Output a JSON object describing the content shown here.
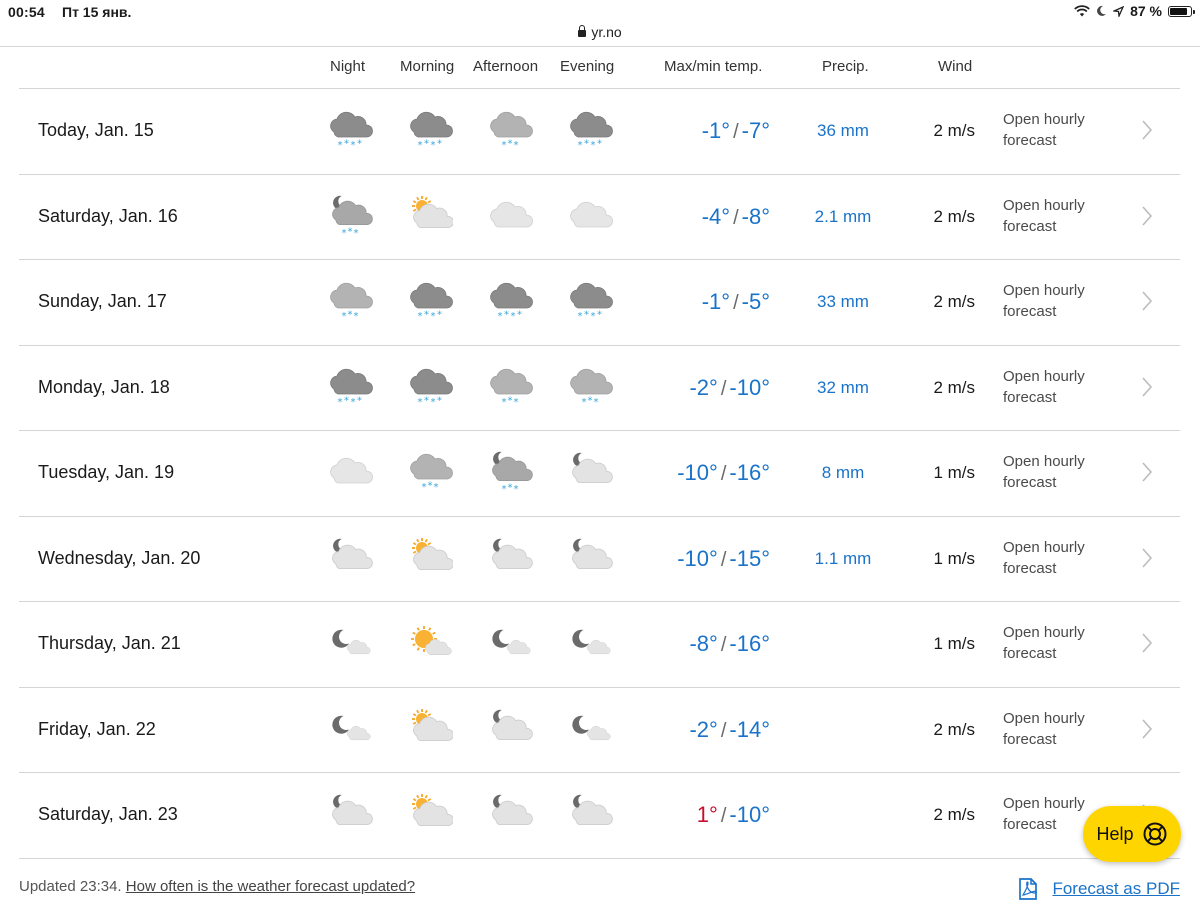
{
  "status_bar": {
    "time": "00:54",
    "date": "Пт 15 янв.",
    "url": "yr.no",
    "battery": "87 %",
    "battery_level": 0.87
  },
  "table": {
    "headers": {
      "night": "Night",
      "morning": "Morning",
      "afternoon": "Afternoon",
      "evening": "Evening",
      "temp": "Max/min temp.",
      "precip": "Precip.",
      "wind": "Wind"
    },
    "rows": [
      {
        "day": "Today, Jan. 15",
        "icons": [
          "heavy-snow",
          "heavy-snow",
          "light-snow",
          "heavy-snow"
        ],
        "max": "-1°",
        "min": "-7°",
        "max_warm": false,
        "precip": "36 mm",
        "wind": "2 m/s",
        "hourly": "Open hourly forecast"
      },
      {
        "day": "Saturday, Jan. 16",
        "icons": [
          "night-cloud-snow",
          "partly-sunny-cloud",
          "light-cloud",
          "light-cloud"
        ],
        "max": "-4°",
        "min": "-8°",
        "max_warm": false,
        "precip": "2.1 mm",
        "wind": "2 m/s",
        "hourly": "Open hourly forecast"
      },
      {
        "day": "Sunday, Jan. 17",
        "icons": [
          "light-snow",
          "heavy-snow",
          "heavy-snow",
          "heavy-snow"
        ],
        "max": "-1°",
        "min": "-5°",
        "max_warm": false,
        "precip": "33 mm",
        "wind": "2 m/s",
        "hourly": "Open hourly forecast"
      },
      {
        "day": "Monday, Jan. 18",
        "icons": [
          "heavy-snow",
          "heavy-snow",
          "light-snow",
          "light-snow"
        ],
        "max": "-2°",
        "min": "-10°",
        "max_warm": false,
        "precip": "32 mm",
        "wind": "2 m/s",
        "hourly": "Open hourly forecast"
      },
      {
        "day": "Tuesday, Jan. 19",
        "icons": [
          "light-cloud",
          "light-snow",
          "night-cloud-snow",
          "night-cloud"
        ],
        "max": "-10°",
        "min": "-16°",
        "max_warm": false,
        "precip": "8 mm",
        "wind": "1 m/s",
        "hourly": "Open hourly forecast"
      },
      {
        "day": "Wednesday, Jan. 20",
        "icons": [
          "night-cloud",
          "partly-sunny-cloud",
          "night-cloud",
          "night-cloud"
        ],
        "max": "-10°",
        "min": "-15°",
        "max_warm": false,
        "precip": "1.1 mm",
        "wind": "1 m/s",
        "hourly": "Open hourly forecast"
      },
      {
        "day": "Thursday, Jan. 21",
        "icons": [
          "moon-small-cloud",
          "sun-small-cloud",
          "moon-small-cloud",
          "moon-small-cloud"
        ],
        "max": "-8°",
        "min": "-16°",
        "max_warm": false,
        "precip": "",
        "wind": "1 m/s",
        "hourly": "Open hourly forecast"
      },
      {
        "day": "Friday, Jan. 22",
        "icons": [
          "moon-small-cloud",
          "partly-sunny-cloud",
          "night-cloud",
          "moon-small-cloud"
        ],
        "max": "-2°",
        "min": "-14°",
        "max_warm": false,
        "precip": "",
        "wind": "2 m/s",
        "hourly": "Open hourly forecast"
      },
      {
        "day": "Saturday, Jan. 23",
        "icons": [
          "night-cloud",
          "partly-sunny-cloud",
          "night-cloud",
          "night-cloud"
        ],
        "max": "1°",
        "min": "-10°",
        "max_warm": true,
        "precip": "",
        "wind": "2 m/s",
        "hourly": "Open hourly forecast"
      }
    ]
  },
  "footer": {
    "updated": "Updated 23:34.",
    "update_link": "How often is the weather forecast updated?",
    "pdf_link": "Forecast as PDF"
  },
  "help_button": {
    "label": "Help",
    "color": "#ffd500"
  },
  "colors": {
    "accent": "#1a73c9",
    "warm_temp": "#c8102e"
  }
}
